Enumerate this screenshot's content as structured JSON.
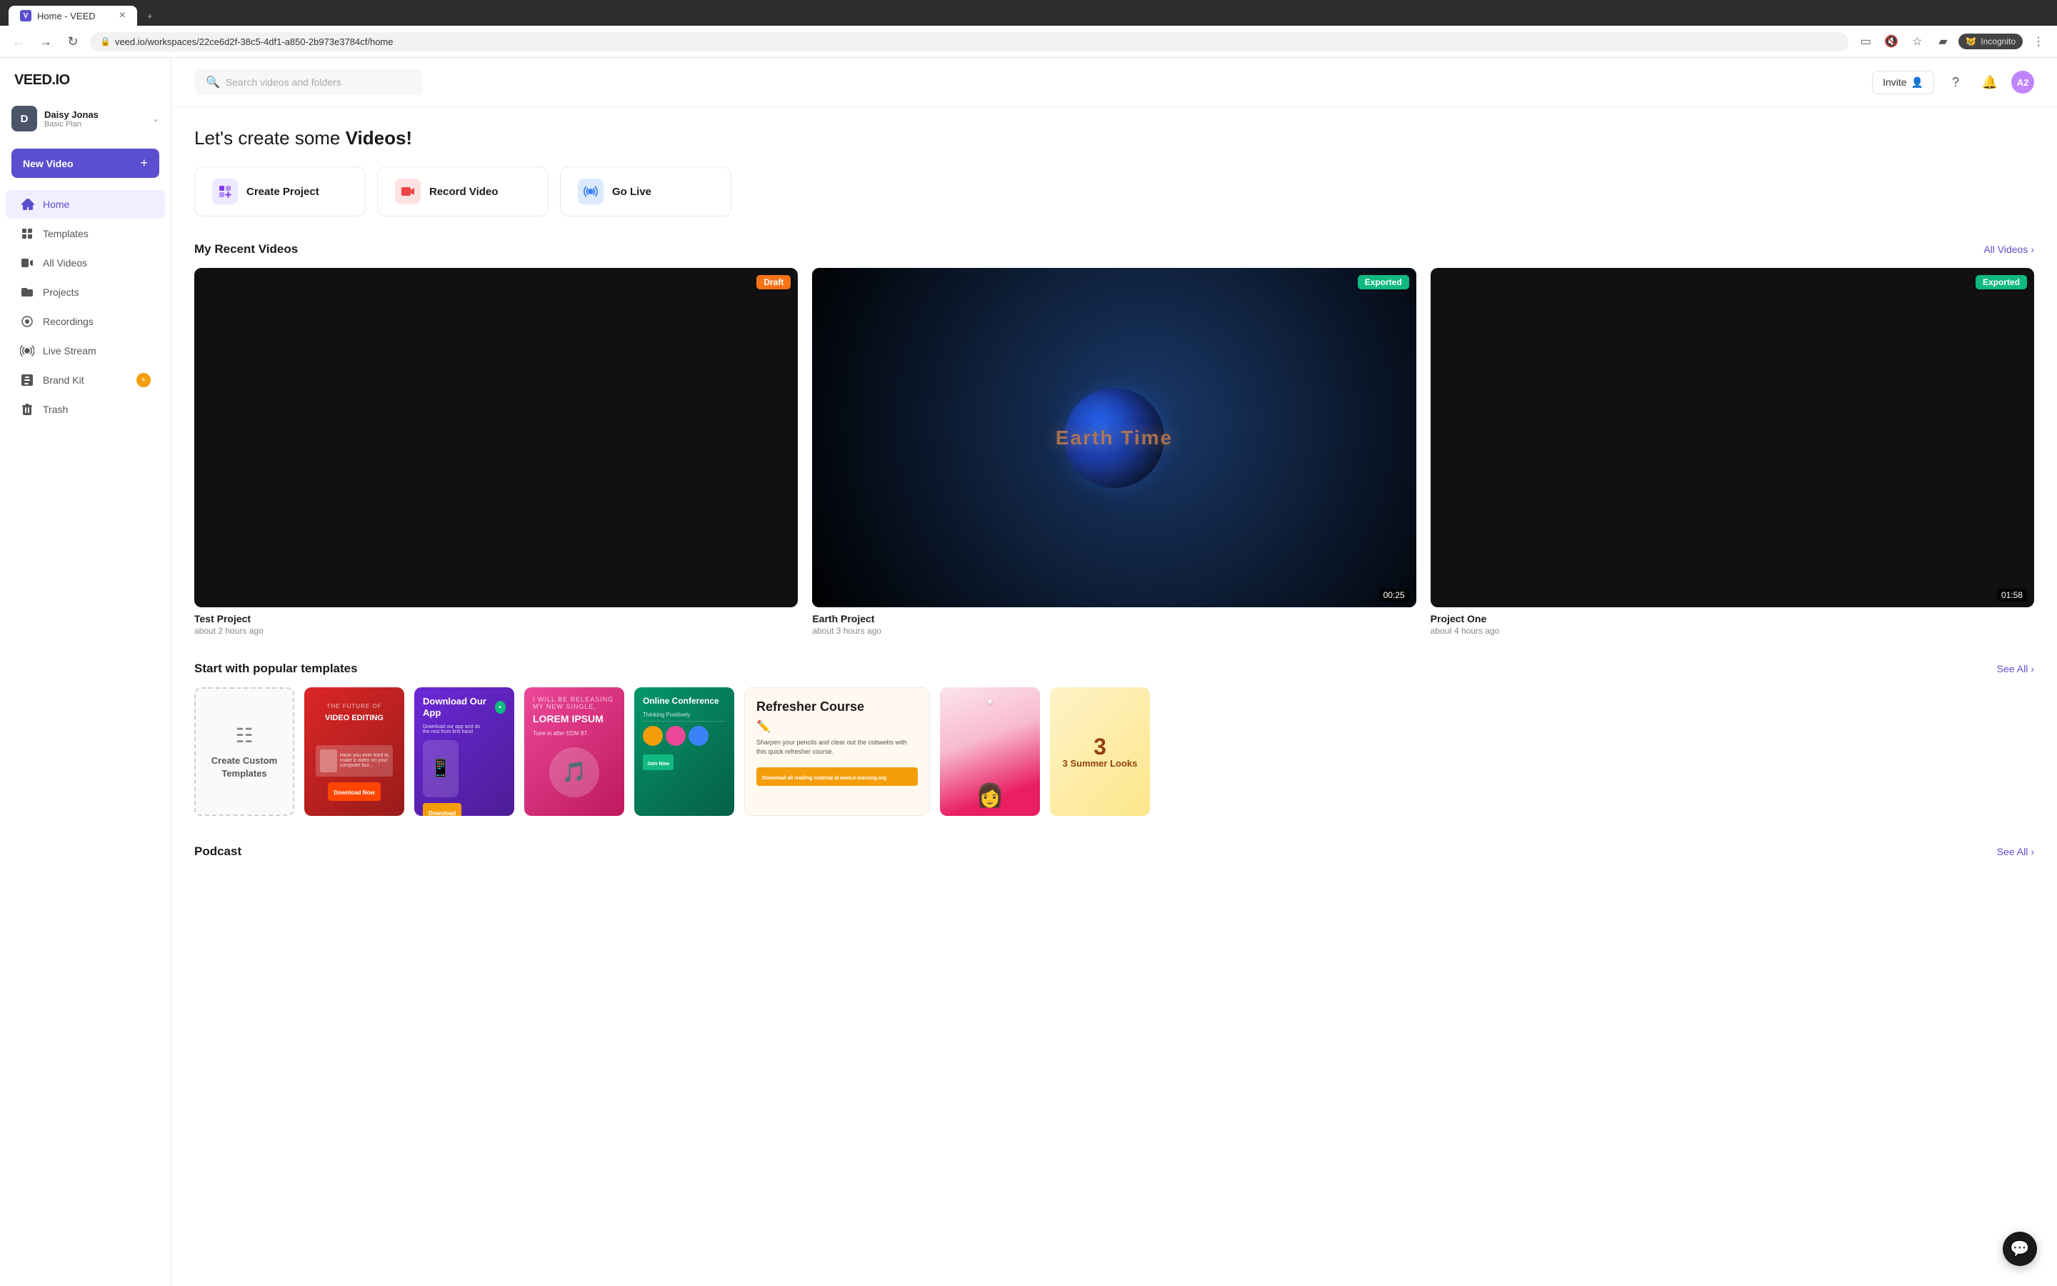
{
  "browser": {
    "tab_label": "Home - VEED",
    "tab_icon": "V",
    "url": "veed.io/workspaces/22ce6d2f-38c5-4df1-a850-2b973e3784cf/home",
    "incognito_label": "Incognito"
  },
  "sidebar": {
    "logo": "VEED.IO",
    "user": {
      "initials": "D",
      "name": "Daisy Jonas",
      "plan": "Basic Plan"
    },
    "new_video_label": "New Video",
    "nav_items": [
      {
        "id": "home",
        "label": "Home",
        "active": true
      },
      {
        "id": "templates",
        "label": "Templates",
        "active": false
      },
      {
        "id": "all-videos",
        "label": "All Videos",
        "active": false
      },
      {
        "id": "projects",
        "label": "Projects",
        "active": false
      },
      {
        "id": "recordings",
        "label": "Recordings",
        "active": false
      },
      {
        "id": "live-stream",
        "label": "Live Stream",
        "active": false
      },
      {
        "id": "brand-kit",
        "label": "Brand Kit",
        "active": false,
        "badge": "+"
      },
      {
        "id": "trash",
        "label": "Trash",
        "active": false
      }
    ]
  },
  "header": {
    "search_placeholder": "Search videos and folders",
    "invite_label": "Invite",
    "user_initials": "A2"
  },
  "main": {
    "page_title_prefix": "Let's create some ",
    "page_title_bold": "Videos!",
    "action_cards": [
      {
        "id": "create-project",
        "label": "Create Project",
        "icon_type": "purple"
      },
      {
        "id": "record-video",
        "label": "Record Video",
        "icon_type": "red"
      },
      {
        "id": "go-live",
        "label": "Go Live",
        "icon_type": "blue"
      }
    ],
    "recent_videos": {
      "title": "My Recent Videos",
      "see_all": "All Videos",
      "items": [
        {
          "id": "test-project",
          "title": "Test Project",
          "time": "about 2 hours ago",
          "badge": "Draft",
          "badge_type": "draft",
          "has_duration": false,
          "is_earth": false
        },
        {
          "id": "earth-project",
          "title": "Earth Project",
          "time": "about 3 hours ago",
          "badge": "Exported",
          "badge_type": "exported",
          "duration": "00:25",
          "is_earth": true
        },
        {
          "id": "project-one",
          "title": "Project One",
          "time": "about 4 hours ago",
          "badge": "Exported",
          "badge_type": "exported",
          "duration": "01:58",
          "is_earth": false
        }
      ]
    },
    "templates": {
      "title": "Start with popular templates",
      "see_all": "See All",
      "items": [
        {
          "id": "create-custom",
          "type": "create-custom",
          "label": "Create Custom Templates"
        },
        {
          "id": "tpl-red",
          "type": "red",
          "subtitle": "THE FUTURE OF VIDEO EDITING"
        },
        {
          "id": "tpl-purple",
          "type": "purple",
          "title": "Download Our App"
        },
        {
          "id": "tpl-pink",
          "type": "pink",
          "title": "LOREM IPSUM"
        },
        {
          "id": "tpl-green",
          "type": "green",
          "title": "Online Conference"
        },
        {
          "id": "tpl-white",
          "type": "white",
          "title": "Refresher Course"
        },
        {
          "id": "tpl-woman",
          "type": "woman"
        },
        {
          "id": "tpl-summer",
          "type": "summer",
          "title": "3 Summer Looks"
        }
      ]
    },
    "podcast": {
      "title": "Podcast",
      "see_all": "See All"
    }
  }
}
